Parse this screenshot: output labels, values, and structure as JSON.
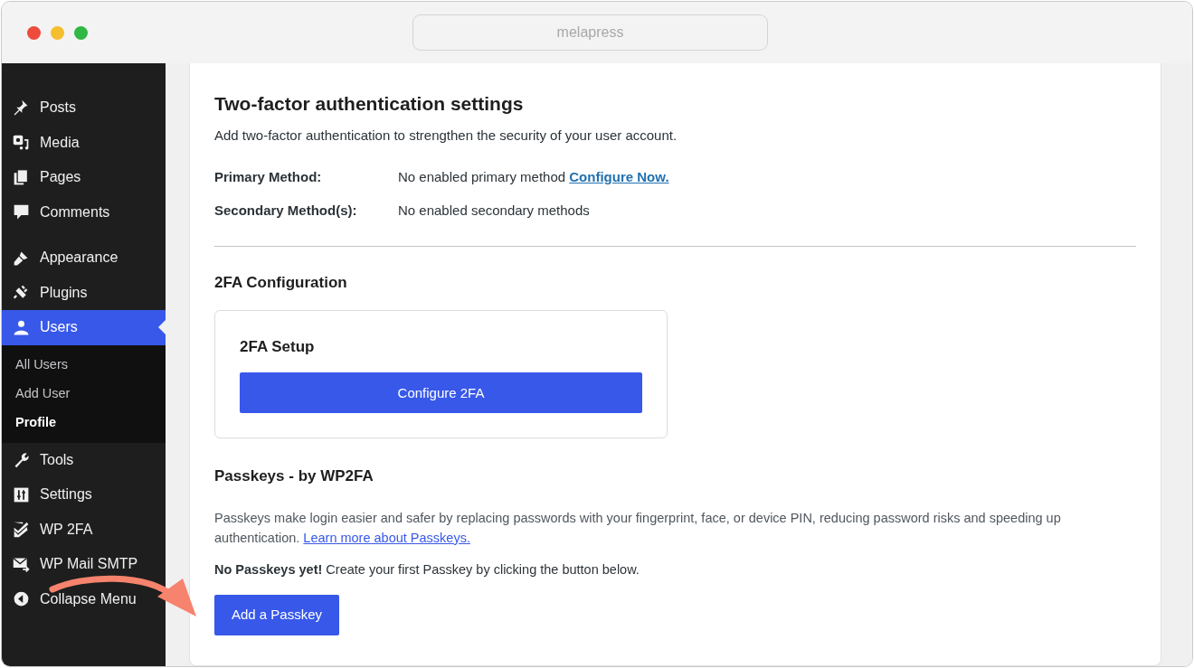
{
  "window": {
    "address": "melapress"
  },
  "sidebar": {
    "groups": [
      [
        {
          "label": "Posts",
          "selected": false
        },
        {
          "label": "Media",
          "selected": false
        },
        {
          "label": "Pages",
          "selected": false
        },
        {
          "label": "Comments",
          "selected": false
        }
      ],
      [
        {
          "label": "Appearance",
          "selected": false
        },
        {
          "label": "Plugins",
          "selected": false
        },
        {
          "label": "Users",
          "selected": true,
          "children": [
            {
              "label": "All Users",
              "selected": false
            },
            {
              "label": "Add User",
              "selected": false
            },
            {
              "label": "Profile",
              "selected": true
            }
          ]
        },
        {
          "label": "Tools",
          "selected": false
        },
        {
          "label": "Settings",
          "selected": false
        },
        {
          "label": "WP 2FA",
          "selected": false
        },
        {
          "label": "WP Mail SMTP",
          "selected": false
        },
        {
          "label": "Collapse Menu",
          "selected": false
        }
      ]
    ]
  },
  "content": {
    "title": "Two-factor authentication settings",
    "subtitle": "Add two-factor authentication to strengthen the security of your user account.",
    "methods": [
      {
        "label": "Primary Method:",
        "value": "No enabled primary method",
        "link": "Configure Now."
      },
      {
        "label": "Secondary Method(s):",
        "value": "No enabled secondary methods"
      }
    ],
    "config_heading": "2FA Configuration",
    "setup_title": "2FA Setup",
    "setup_button": "Configure 2FA",
    "passkeys_heading": "Passkeys - by WP2FA",
    "passkeys_text": "Passkeys make login easier and safer by replacing passwords with your fingerprint, face, or device PIN, reducing password risks and speeding up authentication.",
    "passkeys_link": "Learn more about Passkeys.",
    "passkeys_note": "**No Passkeys yet!** Create your first Passkey by clicking the button below.",
    "passkey_button": "Add a Passkey"
  }
}
